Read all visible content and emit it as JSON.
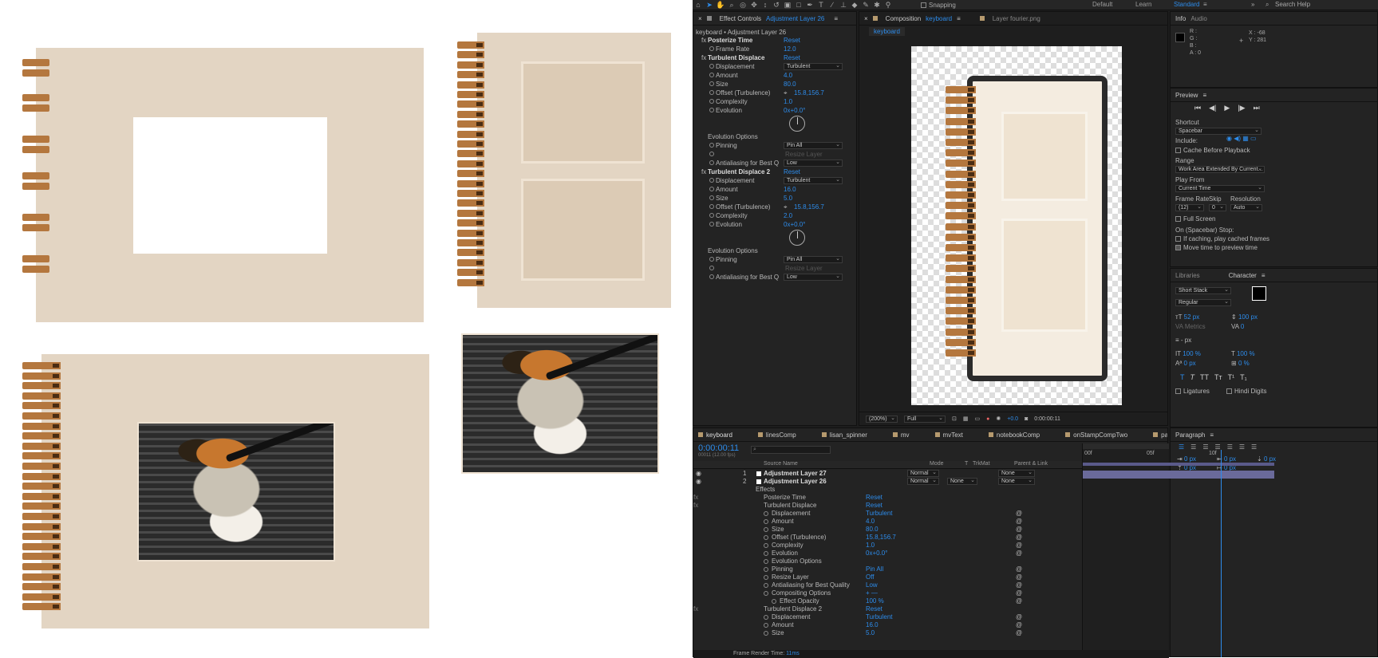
{
  "toolbar": {
    "snapping_label": "Snapping",
    "workspaces": [
      "Default",
      "Learn",
      "Standard"
    ],
    "active_workspace": "Standard",
    "search_placeholder": "Search Help"
  },
  "effect_controls": {
    "tab_label": "Effect Controls",
    "tab_layer": "Adjustment Layer 26",
    "breadcrumb": "keyboard • Adjustment Layer 26",
    "reset": "Reset",
    "rows": [
      {
        "label": "Posterize Time",
        "value": "Reset",
        "type": "fx"
      },
      {
        "label": "Frame Rate",
        "value": "12.0",
        "type": "prop"
      },
      {
        "label": "Turbulent Displace",
        "value": "Reset",
        "type": "fx"
      },
      {
        "label": "Displacement",
        "value": "Turbulent",
        "type": "dropdown"
      },
      {
        "label": "Amount",
        "value": "4.0",
        "type": "prop"
      },
      {
        "label": "Size",
        "value": "80.0",
        "type": "prop"
      },
      {
        "label": "Offset (Turbulence)",
        "value": "15.8,156.7",
        "type": "point"
      },
      {
        "label": "Complexity",
        "value": "1.0",
        "type": "prop"
      },
      {
        "label": "Evolution",
        "value": "0x+0.0°",
        "type": "prop"
      },
      {
        "label": "Evolution Options",
        "value": "",
        "type": "group"
      },
      {
        "label": "Pinning",
        "value": "Pin All",
        "type": "dropdown"
      },
      {
        "label": "",
        "value": "Resize Layer",
        "type": "checkbox"
      },
      {
        "label": "Antialiasing for Best Q",
        "value": "Low",
        "type": "dropdown"
      },
      {
        "label": "Turbulent Displace 2",
        "value": "Reset",
        "type": "fx"
      },
      {
        "label": "Displacement",
        "value": "Turbulent",
        "type": "dropdown"
      },
      {
        "label": "Amount",
        "value": "16.0",
        "type": "prop"
      },
      {
        "label": "Size",
        "value": "5.0",
        "type": "prop"
      },
      {
        "label": "Offset (Turbulence)",
        "value": "15.8,156.7",
        "type": "point"
      },
      {
        "label": "Complexity",
        "value": "2.0",
        "type": "prop"
      },
      {
        "label": "Evolution",
        "value": "0x+0.0°",
        "type": "prop"
      },
      {
        "label": "Evolution Options",
        "value": "",
        "type": "group"
      },
      {
        "label": "Pinning",
        "value": "Pin All",
        "type": "dropdown"
      },
      {
        "label": "",
        "value": "Resize Layer",
        "type": "checkbox"
      },
      {
        "label": "Antialiasing for Best Q",
        "value": "Low",
        "type": "dropdown"
      }
    ]
  },
  "composition": {
    "tab_label": "Composition",
    "tab_comp": "keyboard",
    "layer_tab": "Layer fourier.png",
    "sub_tab": "keyboard",
    "zoom": "(200%)",
    "resolution": "Full",
    "exposure": "+0.0",
    "timecode": "0:00:00:11"
  },
  "info": {
    "tab_info": "Info",
    "tab_audio": "Audio",
    "r": "R :",
    "g": "G :",
    "b": "B :",
    "a": "A : 0",
    "x": "X : -68",
    "y": "Y : 281"
  },
  "preview": {
    "title": "Preview",
    "shortcut_label": "Shortcut",
    "shortcut_value": "Spacebar",
    "include_label": "Include:",
    "cache_label": "Cache Before Playback",
    "range_label": "Range",
    "range_value": "Work Area Extended By Current...",
    "play_from_label": "Play From",
    "play_from_value": "Current Time",
    "frame_rate_label": "Frame Rate",
    "skip_label": "Skip",
    "resolution_label": "Resolution",
    "frame_rate_value": "(12)",
    "skip_value": "0",
    "resolution_value": "Auto",
    "full_screen_label": "Full Screen",
    "on_stop_label": "On (Spacebar) Stop:",
    "if_caching_label": "If caching, play cached frames",
    "move_time_label": "Move time to preview time"
  },
  "character": {
    "tab_libraries": "Libraries",
    "tab_character": "Character",
    "font": "Short Stack",
    "style": "Regular",
    "size": "52 px",
    "leading": "100 px",
    "kerning": "Metrics",
    "tracking": "0",
    "stroke": "- px",
    "vscale": "100 %",
    "hscale": "100 %",
    "baseline": "0 px",
    "tsume": "0 %",
    "ligatures_label": "Ligatures",
    "hindi_label": "Hindi Digits"
  },
  "paragraph": {
    "title": "Paragraph",
    "indent_values": [
      "0 px",
      "0 px",
      "0 px",
      "0 px",
      "0 px"
    ]
  },
  "timeline": {
    "tabs": [
      "keyboard",
      "linesComp",
      "lisan_spinner",
      "mv",
      "mvText",
      "notebookComp",
      "onStampCompTwo",
      "paper"
    ],
    "timecode": "0:00:00:11",
    "fps_label": "00011 (12.00 fps)",
    "col_source": "Source Name",
    "col_mode": "Mode",
    "col_t": "T",
    "col_trkmat": "TrkMat",
    "col_parent": "Parent & Link",
    "ruler_marks": [
      "00f",
      "05f",
      "10f"
    ],
    "layers": [
      {
        "num": "1",
        "name": "Adjustment Layer 27",
        "mode": "Normal",
        "trkmat": "",
        "parent": "None"
      },
      {
        "num": "2",
        "name": "Adjustment Layer 26",
        "mode": "Normal",
        "trkmat": "None",
        "parent": "None"
      }
    ],
    "props": [
      {
        "label": "Effects",
        "value": "",
        "indent": 1
      },
      {
        "label": "Posterize Time",
        "value": "Reset",
        "indent": 2
      },
      {
        "label": "Turbulent Displace",
        "value": "Reset",
        "indent": 2
      },
      {
        "label": "Displacement",
        "value": "Turbulent",
        "indent": 3
      },
      {
        "label": "Amount",
        "value": "4.0",
        "indent": 3
      },
      {
        "label": "Size",
        "value": "80.0",
        "indent": 3
      },
      {
        "label": "Offset (Turbulence)",
        "value": "15.8,156.7",
        "indent": 3
      },
      {
        "label": "Complexity",
        "value": "1.0",
        "indent": 3
      },
      {
        "label": "Evolution",
        "value": "0x+0.0°",
        "indent": 3
      },
      {
        "label": "Evolution Options",
        "value": "",
        "indent": 3
      },
      {
        "label": "Pinning",
        "value": "Pin All",
        "indent": 3
      },
      {
        "label": "Resize Layer",
        "value": "Off",
        "indent": 3
      },
      {
        "label": "Antialiasing for Best Quality",
        "value": "Low",
        "indent": 3
      },
      {
        "label": "Compositing Options",
        "value": "+ —",
        "indent": 3
      },
      {
        "label": "Effect Opacity",
        "value": "100 %",
        "indent": 4
      },
      {
        "label": "Turbulent Displace 2",
        "value": "Reset",
        "indent": 2
      },
      {
        "label": "Displacement",
        "value": "Turbulent",
        "indent": 3
      },
      {
        "label": "Amount",
        "value": "16.0",
        "indent": 3
      },
      {
        "label": "Size",
        "value": "5.0",
        "indent": 3
      }
    ],
    "render_time_label": "Frame Render Time:",
    "render_time_value": "11ms"
  }
}
